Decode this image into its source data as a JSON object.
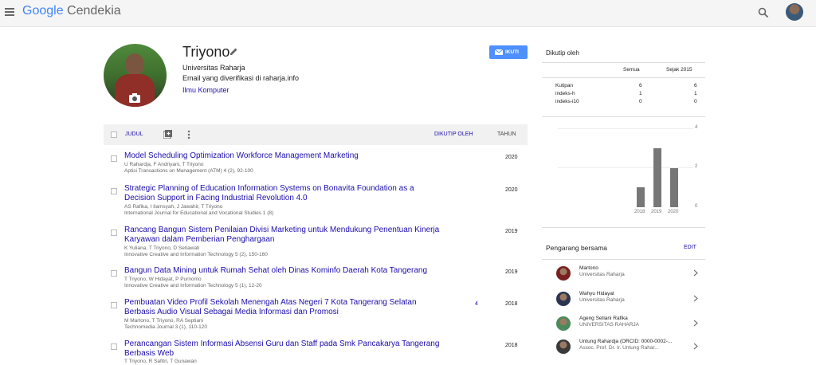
{
  "header": {
    "logo_google": "Google",
    "logo_rest": "Cendekia"
  },
  "profile": {
    "name": "Triyono",
    "affiliation": "Universitas Raharja",
    "email": "Email yang diverifikasi di raharja.info",
    "interest": "Ilmu Komputer",
    "follow_label": "IKUTI"
  },
  "table": {
    "title_col": "JUDUL",
    "cited_col": "DIKUTIP OLEH",
    "year_col": "TAHUN"
  },
  "publications": [
    {
      "title": "Model Scheduling Optimization Workforce Management Marketing",
      "authors": "U Rahardja, F Andriyani, T Triyono",
      "venue": "Aptisi Transactions on Management (ATM) 4 (2), 92-100",
      "cited": "",
      "year": "2020"
    },
    {
      "title": "Strategic Planning of Education Information Systems on Bonavita Foundation as a Decision Support in Facing Industrial Revolution 4.0",
      "authors": "AS Rafika, I Ilamsyah, J Jawahir, T Triyono",
      "venue": "International Journal for Educational and Vocational Studies 1 (8)",
      "cited": "",
      "year": "2020"
    },
    {
      "title": "Rancang Bangun Sistem Penilaian Divisi Marketing untuk Mendukung Penentuan Kinerja Karyawan dalam Pemberian Penghargaan",
      "authors": "K Yuliana, T Triyono, D Setiawati",
      "venue": "Innovative Creative and Information Technology 5 (2), 150-160",
      "cited": "",
      "year": "2019"
    },
    {
      "title": "Bangun Data Mining untuk Rumah Sehat oleh Dinas Kominfo Daerah Kota Tangerang",
      "authors": "T Triyono, W Hidayat, P Purnomo",
      "venue": "Innovative Creative and Information Technology 5 (1), 12-20",
      "cited": "",
      "year": "2019"
    },
    {
      "title": "Pembuatan Video Profil Sekolah Menengah Atas Negeri 7 Kota Tangerang Selatan Berbasis Audio Visual Sebagai Media Informasi dan Promosi",
      "authors": "M Martono, T Triyono, RA Septiani",
      "venue": "Technomedia Journal 3 (1), 110-120",
      "cited": "4",
      "year": "2018"
    },
    {
      "title": "Perancangan Sistem Informasi Absensi Guru dan Staff pada Smk Pancakarya Tangerang Berbasis Web",
      "authors": "T Triyono, R Safitri, T Gunawan",
      "venue": "",
      "cited": "",
      "year": "2018"
    }
  ],
  "cited_by": {
    "title": "Dikutip oleh",
    "col_all": "Semua",
    "col_since": "Sejak 2015",
    "rows": [
      {
        "label": "Kutipan",
        "all": "6",
        "since": "6"
      },
      {
        "label": "indeks-h",
        "all": "1",
        "since": "1"
      },
      {
        "label": "indeks-i10",
        "all": "0",
        "since": "0"
      }
    ]
  },
  "chart_data": {
    "type": "bar",
    "categories": [
      "2018",
      "2019",
      "2020"
    ],
    "values": [
      1,
      3,
      2
    ],
    "yticks": [
      "4",
      "2",
      "0"
    ],
    "ylim": [
      0,
      4
    ]
  },
  "coauthors": {
    "title": "Pengarang bersama",
    "edit_label": "EDIT",
    "items": [
      {
        "name": "Martono",
        "subtitle": "Universitas Raharja",
        "color": "#7a1f1f"
      },
      {
        "name": "Wahyu Hidayat",
        "subtitle": "Universitas Raharja",
        "color": "#2b3550"
      },
      {
        "name": "Ageng Setiani Rafika",
        "subtitle": "UNIVERSITAS RAHARJA",
        "color": "#4b8a5a"
      },
      {
        "name": "Untung Rahardja (ORCID: 0000-0002-...",
        "subtitle": "Assoc. Prof. Dr. Ir. Untung Rahar...",
        "color": "#3a3a3a"
      }
    ]
  }
}
